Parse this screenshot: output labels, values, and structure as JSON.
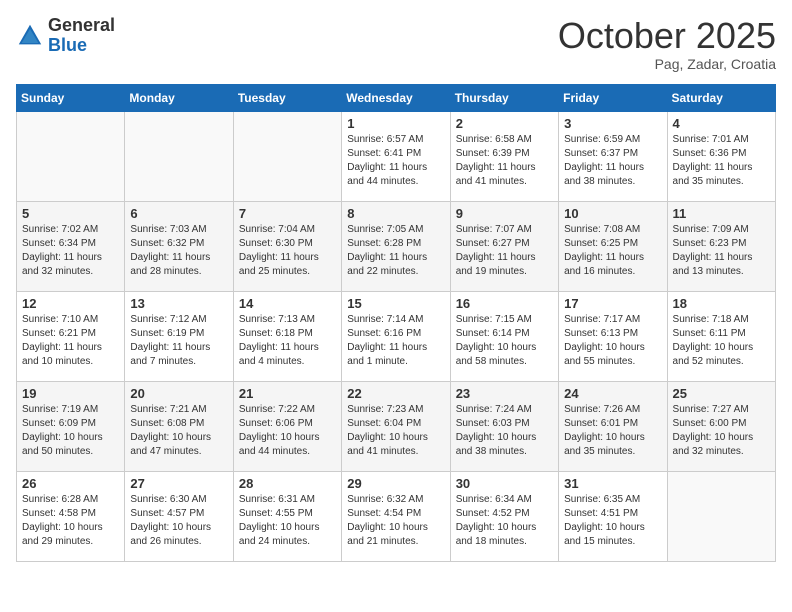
{
  "header": {
    "logo_general": "General",
    "logo_blue": "Blue",
    "month_title": "October 2025",
    "location": "Pag, Zadar, Croatia"
  },
  "days_of_week": [
    "Sunday",
    "Monday",
    "Tuesday",
    "Wednesday",
    "Thursday",
    "Friday",
    "Saturday"
  ],
  "weeks": [
    [
      {
        "day": "",
        "info": ""
      },
      {
        "day": "",
        "info": ""
      },
      {
        "day": "",
        "info": ""
      },
      {
        "day": "1",
        "info": "Sunrise: 6:57 AM\nSunset: 6:41 PM\nDaylight: 11 hours and 44 minutes."
      },
      {
        "day": "2",
        "info": "Sunrise: 6:58 AM\nSunset: 6:39 PM\nDaylight: 11 hours and 41 minutes."
      },
      {
        "day": "3",
        "info": "Sunrise: 6:59 AM\nSunset: 6:37 PM\nDaylight: 11 hours and 38 minutes."
      },
      {
        "day": "4",
        "info": "Sunrise: 7:01 AM\nSunset: 6:36 PM\nDaylight: 11 hours and 35 minutes."
      }
    ],
    [
      {
        "day": "5",
        "info": "Sunrise: 7:02 AM\nSunset: 6:34 PM\nDaylight: 11 hours and 32 minutes."
      },
      {
        "day": "6",
        "info": "Sunrise: 7:03 AM\nSunset: 6:32 PM\nDaylight: 11 hours and 28 minutes."
      },
      {
        "day": "7",
        "info": "Sunrise: 7:04 AM\nSunset: 6:30 PM\nDaylight: 11 hours and 25 minutes."
      },
      {
        "day": "8",
        "info": "Sunrise: 7:05 AM\nSunset: 6:28 PM\nDaylight: 11 hours and 22 minutes."
      },
      {
        "day": "9",
        "info": "Sunrise: 7:07 AM\nSunset: 6:27 PM\nDaylight: 11 hours and 19 minutes."
      },
      {
        "day": "10",
        "info": "Sunrise: 7:08 AM\nSunset: 6:25 PM\nDaylight: 11 hours and 16 minutes."
      },
      {
        "day": "11",
        "info": "Sunrise: 7:09 AM\nSunset: 6:23 PM\nDaylight: 11 hours and 13 minutes."
      }
    ],
    [
      {
        "day": "12",
        "info": "Sunrise: 7:10 AM\nSunset: 6:21 PM\nDaylight: 11 hours and 10 minutes."
      },
      {
        "day": "13",
        "info": "Sunrise: 7:12 AM\nSunset: 6:19 PM\nDaylight: 11 hours and 7 minutes."
      },
      {
        "day": "14",
        "info": "Sunrise: 7:13 AM\nSunset: 6:18 PM\nDaylight: 11 hours and 4 minutes."
      },
      {
        "day": "15",
        "info": "Sunrise: 7:14 AM\nSunset: 6:16 PM\nDaylight: 11 hours and 1 minute."
      },
      {
        "day": "16",
        "info": "Sunrise: 7:15 AM\nSunset: 6:14 PM\nDaylight: 10 hours and 58 minutes."
      },
      {
        "day": "17",
        "info": "Sunrise: 7:17 AM\nSunset: 6:13 PM\nDaylight: 10 hours and 55 minutes."
      },
      {
        "day": "18",
        "info": "Sunrise: 7:18 AM\nSunset: 6:11 PM\nDaylight: 10 hours and 52 minutes."
      }
    ],
    [
      {
        "day": "19",
        "info": "Sunrise: 7:19 AM\nSunset: 6:09 PM\nDaylight: 10 hours and 50 minutes."
      },
      {
        "day": "20",
        "info": "Sunrise: 7:21 AM\nSunset: 6:08 PM\nDaylight: 10 hours and 47 minutes."
      },
      {
        "day": "21",
        "info": "Sunrise: 7:22 AM\nSunset: 6:06 PM\nDaylight: 10 hours and 44 minutes."
      },
      {
        "day": "22",
        "info": "Sunrise: 7:23 AM\nSunset: 6:04 PM\nDaylight: 10 hours and 41 minutes."
      },
      {
        "day": "23",
        "info": "Sunrise: 7:24 AM\nSunset: 6:03 PM\nDaylight: 10 hours and 38 minutes."
      },
      {
        "day": "24",
        "info": "Sunrise: 7:26 AM\nSunset: 6:01 PM\nDaylight: 10 hours and 35 minutes."
      },
      {
        "day": "25",
        "info": "Sunrise: 7:27 AM\nSunset: 6:00 PM\nDaylight: 10 hours and 32 minutes."
      }
    ],
    [
      {
        "day": "26",
        "info": "Sunrise: 6:28 AM\nSunset: 4:58 PM\nDaylight: 10 hours and 29 minutes."
      },
      {
        "day": "27",
        "info": "Sunrise: 6:30 AM\nSunset: 4:57 PM\nDaylight: 10 hours and 26 minutes."
      },
      {
        "day": "28",
        "info": "Sunrise: 6:31 AM\nSunset: 4:55 PM\nDaylight: 10 hours and 24 minutes."
      },
      {
        "day": "29",
        "info": "Sunrise: 6:32 AM\nSunset: 4:54 PM\nDaylight: 10 hours and 21 minutes."
      },
      {
        "day": "30",
        "info": "Sunrise: 6:34 AM\nSunset: 4:52 PM\nDaylight: 10 hours and 18 minutes."
      },
      {
        "day": "31",
        "info": "Sunrise: 6:35 AM\nSunset: 4:51 PM\nDaylight: 10 hours and 15 minutes."
      },
      {
        "day": "",
        "info": ""
      }
    ]
  ]
}
